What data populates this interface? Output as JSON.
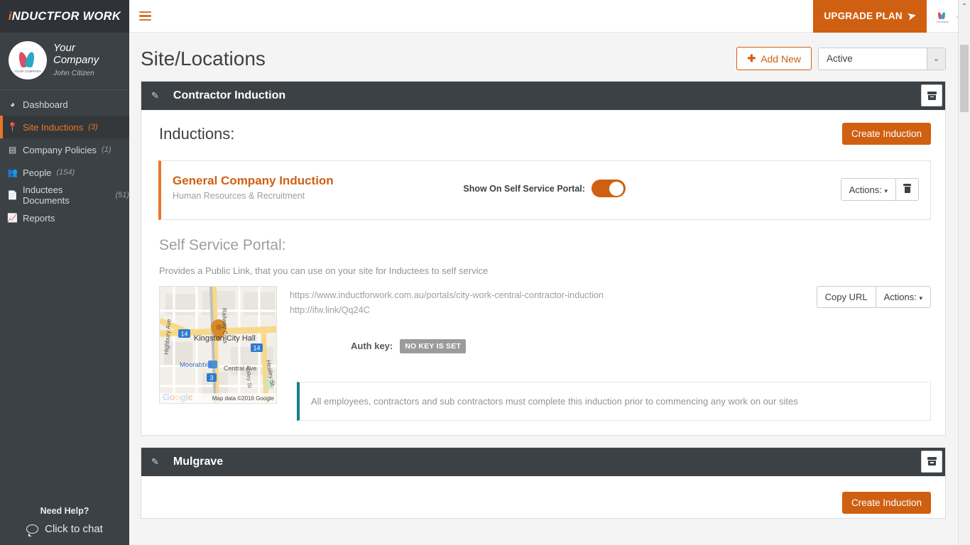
{
  "brand": {
    "part1": "i",
    "part2": "NDUCT",
    "part3": "FOR WORK"
  },
  "profile": {
    "name": "Your Company",
    "subtitle": "John Citizen",
    "logo_caption": "YOUR COMPANY"
  },
  "sidebar": {
    "items": [
      {
        "label": "Dashboard",
        "count": "",
        "icon": "dashboard-icon"
      },
      {
        "label": "Site Inductions",
        "count": "(3)",
        "icon": "location-pin-icon"
      },
      {
        "label": "Company Policies",
        "count": "(1)",
        "icon": "book-icon"
      },
      {
        "label": "People",
        "count": "(154)",
        "icon": "people-icon"
      },
      {
        "label": "Inductees Documents",
        "count": "(51)",
        "icon": "document-icon"
      },
      {
        "label": "Reports",
        "count": "",
        "icon": "chart-line-icon"
      }
    ],
    "footer": {
      "need_help": "Need Help?",
      "chat": "Click to chat"
    }
  },
  "topbar": {
    "upgrade_label": "UPGRADE PLAN",
    "menu_icon": "hamburger-icon",
    "send_icon": "paper-plane-icon"
  },
  "header": {
    "title": "Site/Locations",
    "add_new_label": "Add New",
    "status_value": "Active"
  },
  "panels": [
    {
      "title": "Contractor Induction",
      "inductions_heading": "Inductions:",
      "create_label": "Create Induction",
      "induction": {
        "name": "General Company Induction",
        "category": "Human Resources & Recruitment",
        "toggle_label": "Show On Self Service Portal:",
        "toggle_state": "on",
        "actions_label": "Actions:"
      },
      "ssp": {
        "title": "Self Service Portal:",
        "description": "Provides a Public Link, that you can use on your site for Inductees to self service",
        "url_full": "https://www.inductforwork.com.au/portals/city-work-central-contractor-induction",
        "url_short": "http://ifw.link/Qq24C",
        "copy_label": "Copy URL",
        "actions_label": "Actions:",
        "auth_label": "Auth key:",
        "auth_badge": "NO KEY IS SET",
        "note": "All employees, contractors and sub contractors must complete this induction prior to commencing any work on our sites"
      },
      "map": {
        "place": "Kingston City Hall",
        "suburb": "Moorabbin",
        "streets": [
          "Railway Cres",
          "Highbury Ave",
          "Central Ave",
          "Healey St",
          "Valley St"
        ],
        "route_markers": [
          "14",
          "14",
          "3"
        ],
        "attribution": "Map data ©2016 Google",
        "logo": "Google"
      }
    },
    {
      "title": "Mulgrave"
    }
  ],
  "colors": {
    "accent_orange": "#cf6011",
    "sidebar_dark": "#3c4145",
    "teal": "#157e8a",
    "badge_gray": "#9b9b9b"
  }
}
